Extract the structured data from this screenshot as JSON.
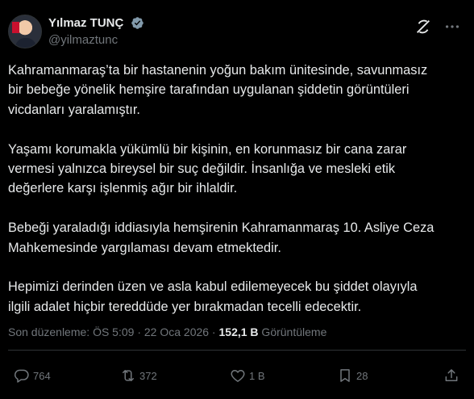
{
  "author": {
    "display_name": "Yılmaz TUNÇ",
    "handle": "@yilmaztunc",
    "verified_color": "#829aab"
  },
  "tweet": {
    "paragraphs": [
      "Kahramanmaraş’ta bir hastanenin yoğun bakım ünitesinde, savunmasız\nbir bebeğe yönelik hemşire tarafından uygulanan şiddetin görüntüleri\nvicdanları yaralamıştır.",
      "Yaşamı korumakla yükümlü bir kişinin, en korunmasız bir cana zarar\nvermesi yalnızca bireysel bir suç değildir. İnsanlığa ve mesleki etik\ndeğerlere karşı işlenmiş ağır bir ihlaldir.",
      "Bebeği yaraladığı iddiasıyla hemşirenin Kahramanmaraş 10. Asliye Ceza\nMahkemesinde yargılaması devam etmektedir.",
      "Hepimizi derinden üzen ve asla kabul edilemeyecek bu şiddet olayıyla\nilgili adalet hiçbir tereddüde yer bırakmadan tecelli edecektir."
    ],
    "meta_prefix": "Son düzenleme: ÖS 5:09 · 22 Oca 2026 · ",
    "views_count": "152,1 B",
    "views_label": " Görüntüleme"
  },
  "actions": {
    "reply_count": "764",
    "repost_count": "372",
    "like_count": "1 B",
    "bookmark_count": "28"
  },
  "icons": [
    "grok-icon",
    "more-icon",
    "verified-icon",
    "reply-icon",
    "repost-icon",
    "like-icon",
    "bookmark-icon",
    "share-icon"
  ],
  "colors": {
    "background": "#000000",
    "text": "#e7e9ea",
    "secondary": "#71767b"
  }
}
